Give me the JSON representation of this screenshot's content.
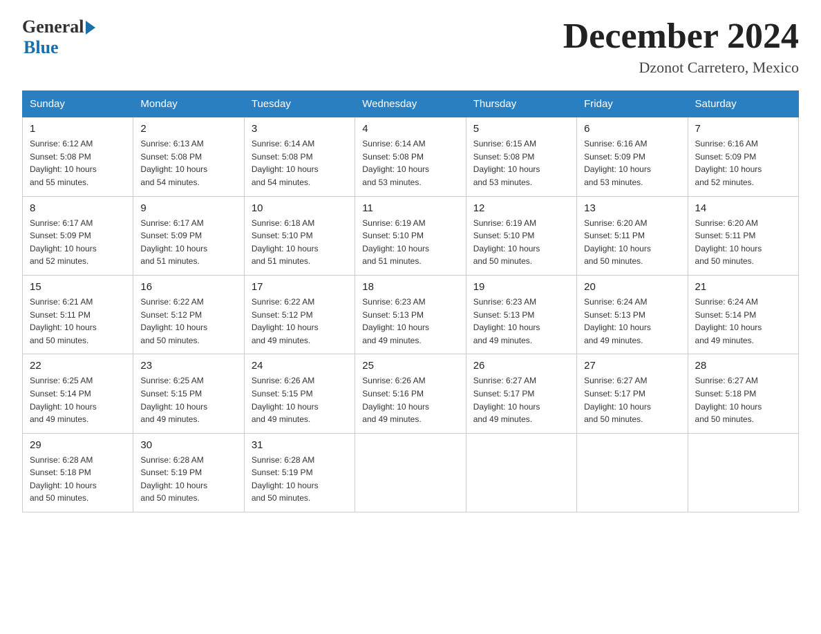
{
  "header": {
    "logo_general": "General",
    "logo_blue": "Blue",
    "month_title": "December 2024",
    "location": "Dzonot Carretero, Mexico"
  },
  "days_of_week": [
    "Sunday",
    "Monday",
    "Tuesday",
    "Wednesday",
    "Thursday",
    "Friday",
    "Saturday"
  ],
  "weeks": [
    [
      {
        "day": "1",
        "sunrise": "6:12 AM",
        "sunset": "5:08 PM",
        "daylight": "10 hours and 55 minutes."
      },
      {
        "day": "2",
        "sunrise": "6:13 AM",
        "sunset": "5:08 PM",
        "daylight": "10 hours and 54 minutes."
      },
      {
        "day": "3",
        "sunrise": "6:14 AM",
        "sunset": "5:08 PM",
        "daylight": "10 hours and 54 minutes."
      },
      {
        "day": "4",
        "sunrise": "6:14 AM",
        "sunset": "5:08 PM",
        "daylight": "10 hours and 53 minutes."
      },
      {
        "day": "5",
        "sunrise": "6:15 AM",
        "sunset": "5:08 PM",
        "daylight": "10 hours and 53 minutes."
      },
      {
        "day": "6",
        "sunrise": "6:16 AM",
        "sunset": "5:09 PM",
        "daylight": "10 hours and 53 minutes."
      },
      {
        "day": "7",
        "sunrise": "6:16 AM",
        "sunset": "5:09 PM",
        "daylight": "10 hours and 52 minutes."
      }
    ],
    [
      {
        "day": "8",
        "sunrise": "6:17 AM",
        "sunset": "5:09 PM",
        "daylight": "10 hours and 52 minutes."
      },
      {
        "day": "9",
        "sunrise": "6:17 AM",
        "sunset": "5:09 PM",
        "daylight": "10 hours and 51 minutes."
      },
      {
        "day": "10",
        "sunrise": "6:18 AM",
        "sunset": "5:10 PM",
        "daylight": "10 hours and 51 minutes."
      },
      {
        "day": "11",
        "sunrise": "6:19 AM",
        "sunset": "5:10 PM",
        "daylight": "10 hours and 51 minutes."
      },
      {
        "day": "12",
        "sunrise": "6:19 AM",
        "sunset": "5:10 PM",
        "daylight": "10 hours and 50 minutes."
      },
      {
        "day": "13",
        "sunrise": "6:20 AM",
        "sunset": "5:11 PM",
        "daylight": "10 hours and 50 minutes."
      },
      {
        "day": "14",
        "sunrise": "6:20 AM",
        "sunset": "5:11 PM",
        "daylight": "10 hours and 50 minutes."
      }
    ],
    [
      {
        "day": "15",
        "sunrise": "6:21 AM",
        "sunset": "5:11 PM",
        "daylight": "10 hours and 50 minutes."
      },
      {
        "day": "16",
        "sunrise": "6:22 AM",
        "sunset": "5:12 PM",
        "daylight": "10 hours and 50 minutes."
      },
      {
        "day": "17",
        "sunrise": "6:22 AM",
        "sunset": "5:12 PM",
        "daylight": "10 hours and 49 minutes."
      },
      {
        "day": "18",
        "sunrise": "6:23 AM",
        "sunset": "5:13 PM",
        "daylight": "10 hours and 49 minutes."
      },
      {
        "day": "19",
        "sunrise": "6:23 AM",
        "sunset": "5:13 PM",
        "daylight": "10 hours and 49 minutes."
      },
      {
        "day": "20",
        "sunrise": "6:24 AM",
        "sunset": "5:13 PM",
        "daylight": "10 hours and 49 minutes."
      },
      {
        "day": "21",
        "sunrise": "6:24 AM",
        "sunset": "5:14 PM",
        "daylight": "10 hours and 49 minutes."
      }
    ],
    [
      {
        "day": "22",
        "sunrise": "6:25 AM",
        "sunset": "5:14 PM",
        "daylight": "10 hours and 49 minutes."
      },
      {
        "day": "23",
        "sunrise": "6:25 AM",
        "sunset": "5:15 PM",
        "daylight": "10 hours and 49 minutes."
      },
      {
        "day": "24",
        "sunrise": "6:26 AM",
        "sunset": "5:15 PM",
        "daylight": "10 hours and 49 minutes."
      },
      {
        "day": "25",
        "sunrise": "6:26 AM",
        "sunset": "5:16 PM",
        "daylight": "10 hours and 49 minutes."
      },
      {
        "day": "26",
        "sunrise": "6:27 AM",
        "sunset": "5:17 PM",
        "daylight": "10 hours and 49 minutes."
      },
      {
        "day": "27",
        "sunrise": "6:27 AM",
        "sunset": "5:17 PM",
        "daylight": "10 hours and 50 minutes."
      },
      {
        "day": "28",
        "sunrise": "6:27 AM",
        "sunset": "5:18 PM",
        "daylight": "10 hours and 50 minutes."
      }
    ],
    [
      {
        "day": "29",
        "sunrise": "6:28 AM",
        "sunset": "5:18 PM",
        "daylight": "10 hours and 50 minutes."
      },
      {
        "day": "30",
        "sunrise": "6:28 AM",
        "sunset": "5:19 PM",
        "daylight": "10 hours and 50 minutes."
      },
      {
        "day": "31",
        "sunrise": "6:28 AM",
        "sunset": "5:19 PM",
        "daylight": "10 hours and 50 minutes."
      },
      null,
      null,
      null,
      null
    ]
  ],
  "labels": {
    "sunrise": "Sunrise:",
    "sunset": "Sunset:",
    "daylight": "Daylight:"
  }
}
